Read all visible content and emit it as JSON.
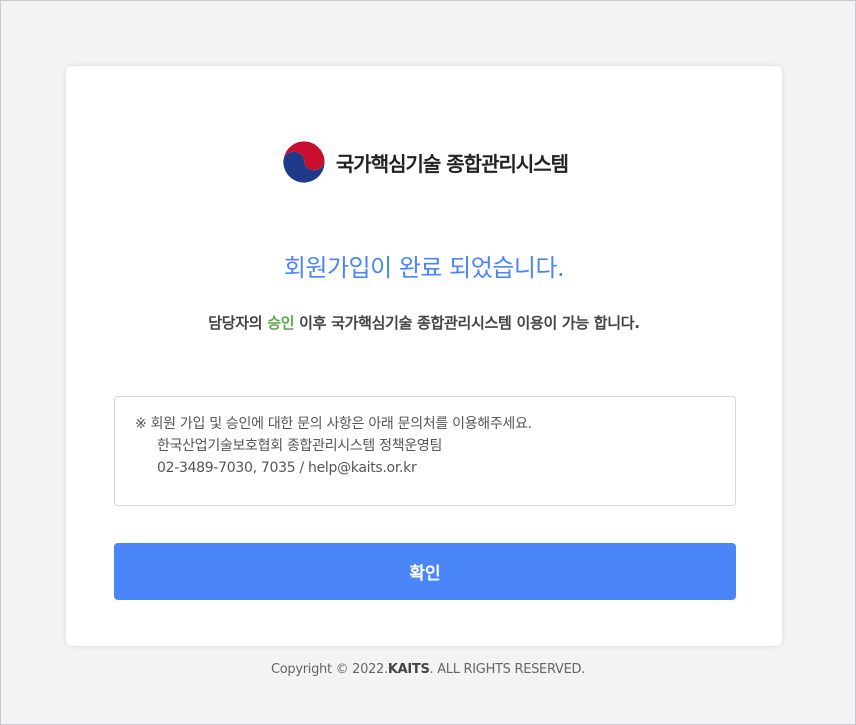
{
  "logo": {
    "icon": "taegeuk-emblem-icon",
    "text": "국가핵심기술 종합관리시스템"
  },
  "title": "회원가입이 완료 되었습니다.",
  "subtitle": {
    "before": "담당자의 ",
    "highlight": "승인",
    "after": " 이후 국가핵심기술 종합관리시스템 이용이 가능 합니다."
  },
  "notice": {
    "line1": "※ 회원 가입 및 승인에 대한 문의 사항은 아래 문의처를 이용해주세요.",
    "line2": "한국산업기술보호협회 종합관리시스템 정책운영팀",
    "line3": "02-3489-7030, 7035 / help@kaits.or.kr"
  },
  "confirm_label": "확인",
  "copyright": {
    "prefix": "Copyright © 2022.",
    "brand": "KAITS",
    "suffix": ". ALL RIGHTS RESERVED."
  },
  "colors": {
    "accent": "#4a86f7",
    "highlight": "#5aa84a",
    "emblem_red": "#c8102e",
    "emblem_blue": "#1f3a8a"
  }
}
